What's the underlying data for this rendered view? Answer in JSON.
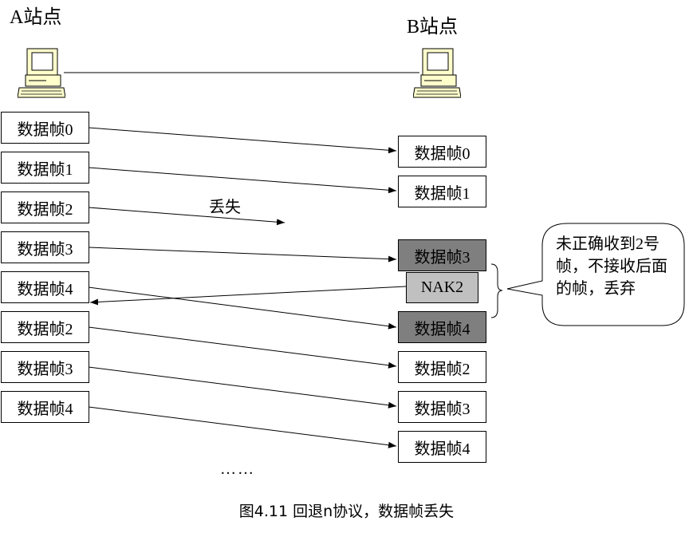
{
  "stations": {
    "a_label": "A站点",
    "b_label": "B站点",
    "a_icon": "computer-icon",
    "b_icon": "computer-icon"
  },
  "sender_frames": [
    "数据帧0",
    "数据帧1",
    "数据帧2",
    "数据帧3",
    "数据帧4",
    "数据帧2",
    "数据帧3",
    "数据帧4"
  ],
  "receiver_frames": [
    "数据帧0",
    "数据帧1",
    "数据帧3",
    "NAK2",
    "数据帧4",
    "数据帧2",
    "数据帧3",
    "数据帧4"
  ],
  "lost_label": "丢失",
  "callout_text": "未正确收到2号帧，不接收后面的帧，丢弃",
  "ellipsis": "……",
  "caption": "图4.11 回退n协议，数据帧丢失",
  "colors": {
    "discarded_frame": "#7f7f7f",
    "nak_frame": "#c0c0c0",
    "line": "#000000"
  }
}
